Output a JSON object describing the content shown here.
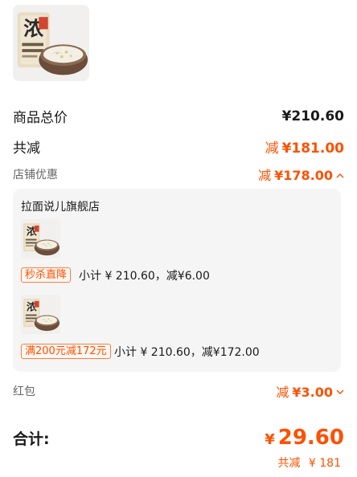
{
  "product": {
    "image_icon": "noodle-bowl-package-image",
    "package_text": "浓"
  },
  "summary": {
    "goods_total_label": "商品总价",
    "goods_total_value": "¥210.60",
    "total_discount_label": "共减",
    "total_discount_prefix": "减",
    "total_discount_value": "¥181.00",
    "store_discount_label": "店铺优惠",
    "store_discount_prefix": "减",
    "store_discount_value": "¥178.00",
    "store_toggle_icon": "chevron-up-icon"
  },
  "store": {
    "name": "拉面说儿旗舰店",
    "items": [
      {
        "tag": "秒杀直降",
        "subtotal": "小计 ¥ 210.60，减¥6.00"
      },
      {
        "tag": "满200元减172元",
        "subtotal": "小计 ¥ 210.60，减¥172.00"
      }
    ]
  },
  "red_packet": {
    "label": "红包",
    "prefix": "减",
    "value": "¥3.00",
    "toggle_icon": "chevron-down-icon"
  },
  "total": {
    "label": "合计:",
    "currency": "¥",
    "value": "29.60",
    "saved_label": "共减",
    "saved_value": "¥ 181"
  },
  "colors": {
    "accent": "#ff5000",
    "panel_bg": "#f5f5f5"
  }
}
